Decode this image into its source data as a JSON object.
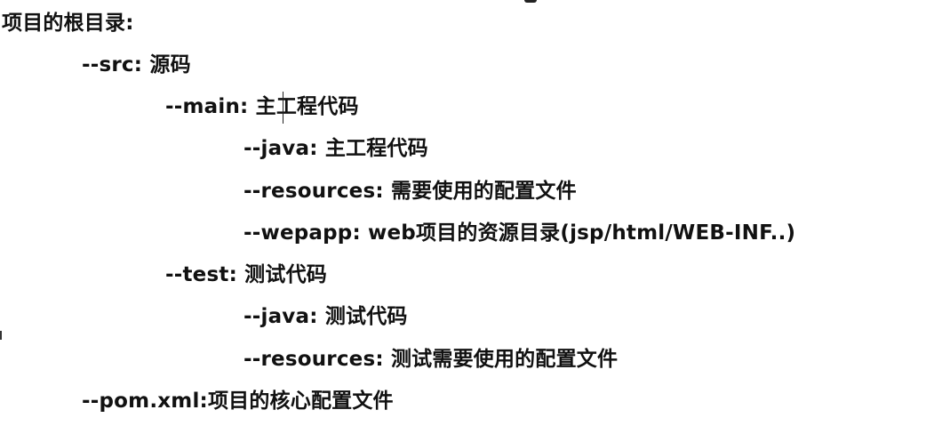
{
  "lines": [
    {
      "text": "项目的根目录:"
    },
    {
      "text": "--src: 源码"
    },
    {
      "text": "--main: 主工程代码"
    },
    {
      "text": "--java: 主工程代码"
    },
    {
      "text": "--resources: 需要使用的配置文件"
    },
    {
      "text": "--wepapp: web项目的资源目录(jsp/html/WEB-INF..)"
    },
    {
      "text": "--test: 测试代码"
    },
    {
      "text": "--java: 测试代码"
    },
    {
      "text": "--resources: 测试需要使用的配置文件"
    },
    {
      "text": "--pom.xml:项目的核心配置文件"
    }
  ],
  "colors": {
    "background": "#ffffff",
    "text": "#111111"
  }
}
